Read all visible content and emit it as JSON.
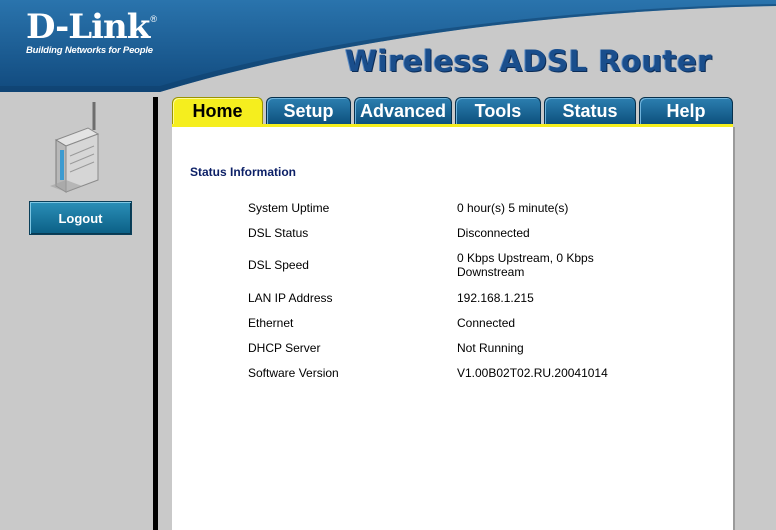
{
  "brand": {
    "name": "D-Link",
    "registered": "®",
    "tagline": "Building Networks for People"
  },
  "product_title": "Wireless ADSL Router",
  "colors": {
    "header_blue": "#1b5f96",
    "tab_active": "#f5ee1e",
    "tab_inactive": "#1a6699",
    "section_title": "#0b1f66",
    "background": "#c9c9c9"
  },
  "sidebar": {
    "device_icon": "adsl-router-icon",
    "logout_label": "Logout"
  },
  "tabs": [
    {
      "label": "Home",
      "active": true
    },
    {
      "label": "Setup",
      "active": false
    },
    {
      "label": "Advanced",
      "active": false
    },
    {
      "label": "Tools",
      "active": false
    },
    {
      "label": "Status",
      "active": false
    },
    {
      "label": "Help",
      "active": false
    }
  ],
  "status": {
    "title": "Status Information",
    "rows": [
      {
        "label": "System Uptime",
        "value": "0 hour(s) 5 minute(s)"
      },
      {
        "label": "DSL Status",
        "value": "Disconnected"
      },
      {
        "label": "DSL Speed",
        "value": "0 Kbps Upstream, 0 Kbps Downstream"
      },
      {
        "label": "LAN IP Address",
        "value": "192.168.1.215"
      },
      {
        "label": "Ethernet",
        "value": "Connected"
      },
      {
        "label": "DHCP Server",
        "value": "Not Running"
      },
      {
        "label": "Software Version",
        "value": "V1.00B02T02.RU.20041014"
      }
    ]
  }
}
